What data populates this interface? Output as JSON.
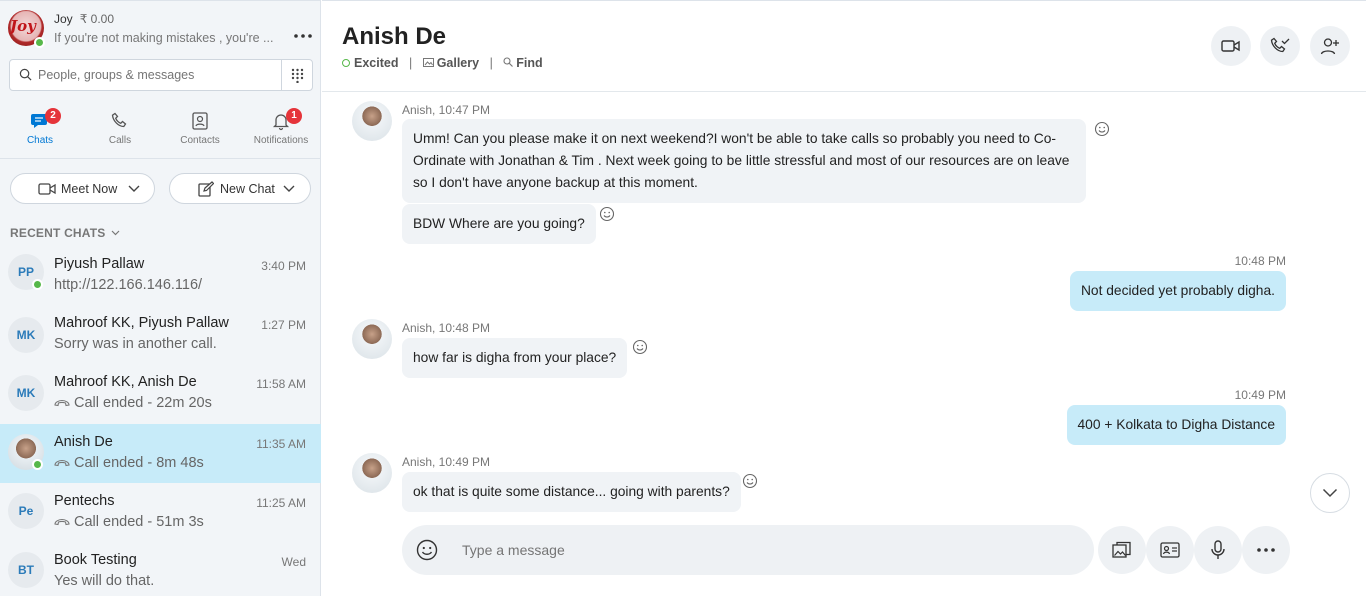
{
  "profile": {
    "name": "Joy",
    "credit": "₹ 0.00",
    "status": "If you're not making mistakes , you're ..."
  },
  "search": {
    "placeholder": "People, groups & messages"
  },
  "nav": {
    "chats": {
      "label": "Chats",
      "badge": "2"
    },
    "calls": {
      "label": "Calls"
    },
    "contacts": {
      "label": "Contacts"
    },
    "notifications": {
      "label": "Notifications",
      "badge": "1"
    }
  },
  "actions": {
    "meet_now": "Meet Now",
    "new_chat": "New Chat"
  },
  "recent_label": "RECENT CHATS",
  "chats": [
    {
      "initials": "PP",
      "name": "Piyush Pallaw",
      "time": "3:40 PM",
      "message": "http://122.166.146.116/"
    },
    {
      "initials": "MK",
      "name": "Mahroof KK, Piyush Pallaw",
      "time": "1:27 PM",
      "message": "Sorry was in another call."
    },
    {
      "initials": "MK",
      "name": "Mahroof KK, Anish De",
      "time": "11:58 AM",
      "message": "Call ended - 22m 20s"
    },
    {
      "initials": "",
      "name": "Anish De",
      "time": "11:35 AM",
      "message": "Call ended - 8m 48s"
    },
    {
      "initials": "Pe",
      "name": "Pentechs",
      "time": "11:25 AM",
      "message": "Call ended - 51m 3s"
    },
    {
      "initials": "BT",
      "name": "Book Testing",
      "time": "Wed",
      "message": "Yes will do that."
    }
  ],
  "conversation": {
    "title": "Anish De",
    "mood": "Excited",
    "gallery": "Gallery",
    "find": "Find",
    "messages": [
      {
        "meta": "Anish, 10:47 PM",
        "text": "Umm! Can you please make it on next weekend?I won't be able to take calls so probably you need to Co-Ordinate with Jonathan & Tim . Next week going to be little stressful and most of our resources are on leave so I don't have anyone backup at this moment."
      },
      {
        "text": "BDW Where are you going?"
      },
      {
        "time": "10:48 PM",
        "text": "Not decided yet probably digha."
      },
      {
        "meta": "Anish, 10:48 PM",
        "text": "how far is digha from your place?"
      },
      {
        "time": "10:49 PM",
        "text": "400 + Kolkata to Digha Distance"
      },
      {
        "meta": "Anish, 10:49 PM",
        "text": "ok that is quite some distance... going with parents?"
      }
    ]
  },
  "composer": {
    "placeholder": "Type a message"
  },
  "colors": {
    "accent": "#0078d4",
    "online": "#57b84a",
    "badge": "#e5343a",
    "outgoing_bubble": "#c7ebf9",
    "incoming_bubble": "#f0f3f6"
  }
}
